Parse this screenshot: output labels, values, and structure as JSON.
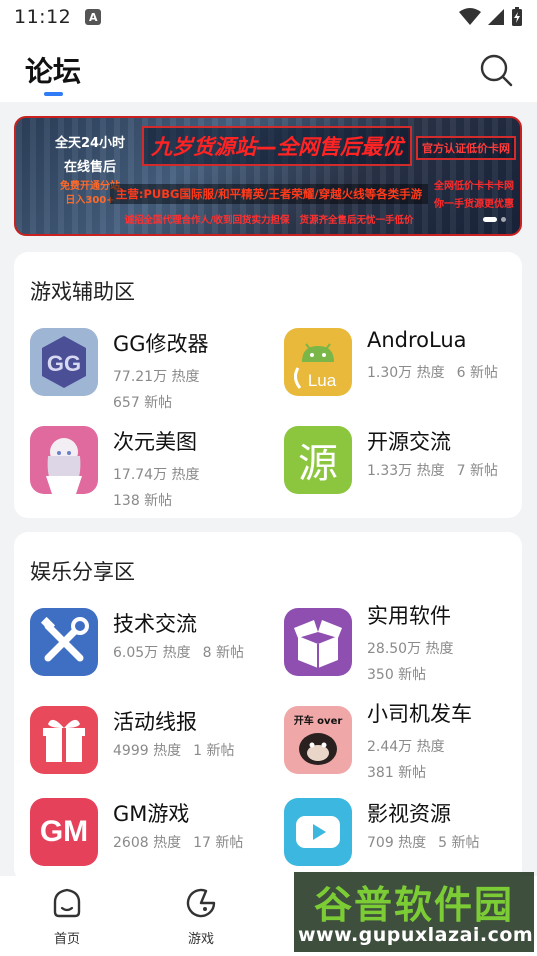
{
  "status_bar": {
    "time": "11:12",
    "notification_letter": "A"
  },
  "header": {
    "title": "论坛"
  },
  "banner": {
    "left_lines": [
      "全天24小时",
      "在线售后"
    ],
    "left_promo_lines": [
      "免费开通分站",
      "日入300+"
    ],
    "headline": "九岁货源站—全网售后最优",
    "badge": "官方认证低价卡网",
    "main_line": "主营:PUBG国际服/和平精英/王者荣耀/穿越火线等各类手游",
    "sub_line_left": "诚招全国代理合作人/收到回货实力担保",
    "sub_line_right": "货源齐全售后无忧一手低价",
    "right_lines": [
      "全网低价卡卡卡网",
      "你一手货源更优惠"
    ]
  },
  "sections": [
    {
      "title": "游戏辅助区",
      "items": [
        {
          "name": "GG修改器",
          "heat": "77.21万 热度",
          "posts": "657 新帖",
          "icon": "gg-icon",
          "icon_color": "#4a4f96"
        },
        {
          "name": "AndroLua",
          "heat": "1.30万 热度",
          "posts": "6 新帖",
          "icon": "androlua-icon",
          "icon_color": "#e8b93a"
        },
        {
          "name": "次元美图",
          "heat": "17.74万 热度",
          "posts": "138 新帖",
          "icon": "anime-girl-icon",
          "icon_color": "#e06a9e"
        },
        {
          "name": "开源交流",
          "heat": "1.33万 热度",
          "posts": "7 新帖",
          "icon": "yuan-icon",
          "icon_color": "#8cc63f",
          "icon_text": "源"
        }
      ]
    },
    {
      "title": "娱乐分享区",
      "items": [
        {
          "name": "技术交流",
          "heat": "6.05万 热度",
          "posts": "8 新帖",
          "icon": "tools-icon",
          "icon_color": "#3f6fc3"
        },
        {
          "name": "实用软件",
          "heat": "28.50万 热度",
          "posts": "350 新帖",
          "icon": "box-icon",
          "icon_color": "#8e4fb1"
        },
        {
          "name": "活动线报",
          "heat": "4999 热度",
          "posts": "1 新帖",
          "icon": "gift-icon",
          "icon_color": "#e94a5b"
        },
        {
          "name": "小司机发车",
          "heat": "2.44万 热度",
          "posts": "381 新帖",
          "icon": "meme-icon",
          "icon_color": "#f0a7a7",
          "icon_caption": "开车 over"
        },
        {
          "name": "GM游戏",
          "heat": "2608 热度",
          "posts": "17 新帖",
          "icon": "gm-icon",
          "icon_color": "#e6415a",
          "icon_text": "GM"
        },
        {
          "name": "影视资源",
          "heat": "709 热度",
          "posts": "5 新帖",
          "icon": "video-icon",
          "icon_color": "#3cb7e0"
        }
      ]
    }
  ],
  "bottom_nav": [
    {
      "label": "首页",
      "icon": "home-icon"
    },
    {
      "label": "游戏",
      "icon": "game-icon"
    }
  ],
  "watermark": {
    "cn": "谷普软件园",
    "url": "www.gupuxlazai.com"
  }
}
